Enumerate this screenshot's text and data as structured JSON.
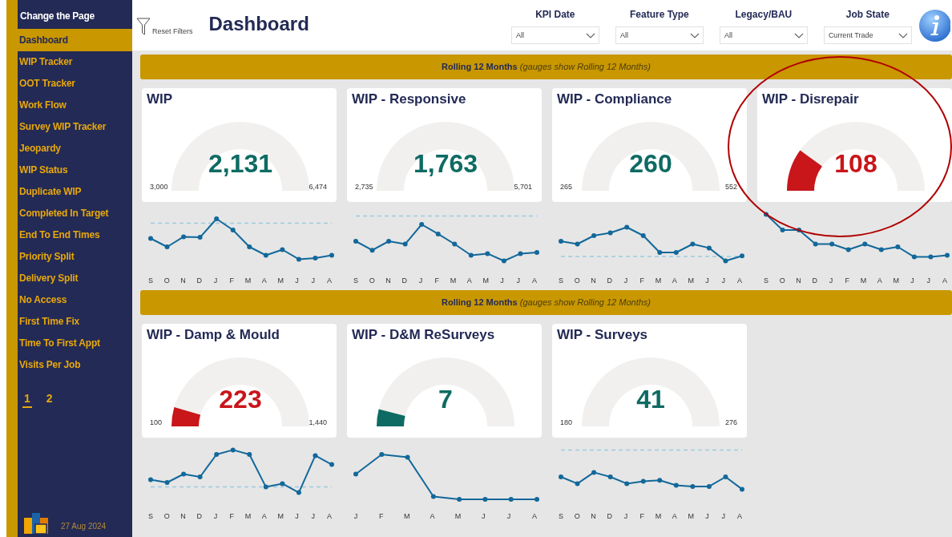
{
  "sidebar": {
    "header": "Change the Page",
    "items": [
      {
        "label": "Dashboard",
        "selected": true
      },
      {
        "label": "WIP Tracker",
        "selected": false
      },
      {
        "label": "OOT Tracker",
        "selected": false
      },
      {
        "label": "Work Flow",
        "selected": false
      },
      {
        "label": "Survey WIP Tracker",
        "selected": false
      },
      {
        "label": "Jeopardy",
        "selected": false
      },
      {
        "label": "WIP Status",
        "selected": false
      },
      {
        "label": "Duplicate WIP",
        "selected": false
      },
      {
        "label": "Completed In Target",
        "selected": false
      },
      {
        "label": "End To End Times",
        "selected": false
      },
      {
        "label": "Priority Split",
        "selected": false
      },
      {
        "label": "Delivery Split",
        "selected": false
      },
      {
        "label": "No Access",
        "selected": false
      },
      {
        "label": "First Time Fix",
        "selected": false
      },
      {
        "label": "Time To First Appt",
        "selected": false
      },
      {
        "label": "Visits Per Job",
        "selected": false
      }
    ],
    "pages": [
      {
        "label": "1",
        "selected": true
      },
      {
        "label": "2",
        "selected": false
      }
    ],
    "date": "27 Aug 2024"
  },
  "toolbar": {
    "reset": "Reset Filters",
    "title": "Dashboard",
    "filters": [
      {
        "label": "KPI Date",
        "value": "All"
      },
      {
        "label": "Feature Type",
        "value": "All"
      },
      {
        "label": "Legacy/BAU",
        "value": "All"
      },
      {
        "label": "Job State",
        "value": "Current Trade"
      }
    ]
  },
  "sections": [
    {
      "banner": "**Rolling 12 Months** *(gauges show Rolling 12 Months)*",
      "cards": [
        {
          "title": "WIP",
          "value": "2,131",
          "min": "3,000",
          "max": "6,474",
          "color": "#0e6b63",
          "months": [
            "S",
            "O",
            "N",
            "D",
            "J",
            "F",
            "M",
            "A",
            "M",
            "J",
            "J",
            "A"
          ]
        },
        {
          "title": "WIP - Responsive",
          "value": "1,763",
          "min": "2,735",
          "max": "5,701",
          "color": "#0e6b63",
          "months": [
            "S",
            "O",
            "N",
            "D",
            "J",
            "F",
            "M",
            "A",
            "M",
            "J",
            "J",
            "A"
          ]
        },
        {
          "title": "WIP - Compliance",
          "value": "260",
          "min": "265",
          "max": "552",
          "color": "#0e6b63",
          "months": [
            "S",
            "O",
            "N",
            "D",
            "J",
            "F",
            "M",
            "A",
            "M",
            "J",
            "J",
            "A"
          ]
        },
        {
          "title": "WIP - Disrepair",
          "value": "108",
          "color": "#c8161b",
          "months": [
            "S",
            "O",
            "N",
            "D",
            "J",
            "F",
            "M",
            "A",
            "M",
            "J",
            "J",
            "A"
          ]
        }
      ]
    },
    {
      "banner": "**Rolling 12 Months** *(gauges show Rolling 12 Months)*",
      "cards": [
        {
          "title": "WIP - Damp & Mould",
          "value": "223",
          "min": "100",
          "max": "1,440",
          "color": "#c8161b",
          "months": [
            "S",
            "O",
            "N",
            "D",
            "J",
            "F",
            "M",
            "A",
            "M",
            "J",
            "J",
            "A"
          ]
        },
        {
          "title": "WIP - D&M ReSurveys",
          "value": "7",
          "color": "#0e6b63",
          "months": [
            "J",
            "F",
            "M",
            "A",
            "M",
            "J",
            "J",
            "A"
          ]
        },
        {
          "title": "WIP - Surveys",
          "value": "41",
          "min": "180",
          "max": "276",
          "color": "#0e6b63",
          "months": [
            "S",
            "O",
            "N",
            "D",
            "J",
            "F",
            "M",
            "A",
            "M",
            "J",
            "J",
            "A"
          ]
        }
      ]
    }
  ]
}
